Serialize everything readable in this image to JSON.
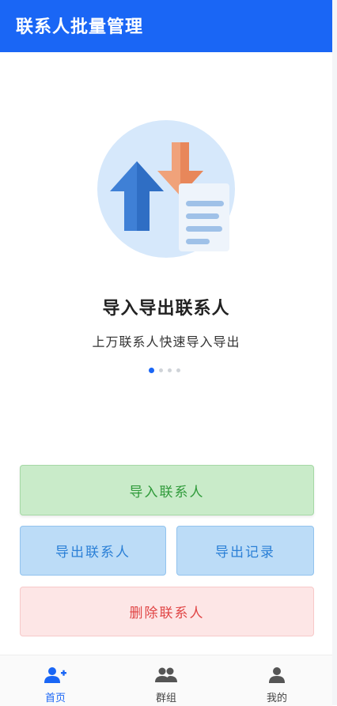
{
  "app": {
    "title": "联系人批量管理"
  },
  "hero": {
    "headline": "导入导出联系人",
    "subline": "上万联系人快速导入导出",
    "pager_total": 4,
    "pager_active": 1
  },
  "actions": {
    "import_label": "导入联系人",
    "export_label": "导出联系人",
    "records_label": "导出记录",
    "delete_label": "删除联系人"
  },
  "tabs": [
    {
      "label": "首页",
      "icon": "add-user-icon",
      "active": true
    },
    {
      "label": "群组",
      "icon": "group-icon",
      "active": false
    },
    {
      "label": "我的",
      "icon": "person-icon",
      "active": false
    }
  ],
  "colors": {
    "primary": "#1a66f5",
    "import": "#2f9a3a",
    "export": "#2a7fd6",
    "delete": "#e04444"
  }
}
